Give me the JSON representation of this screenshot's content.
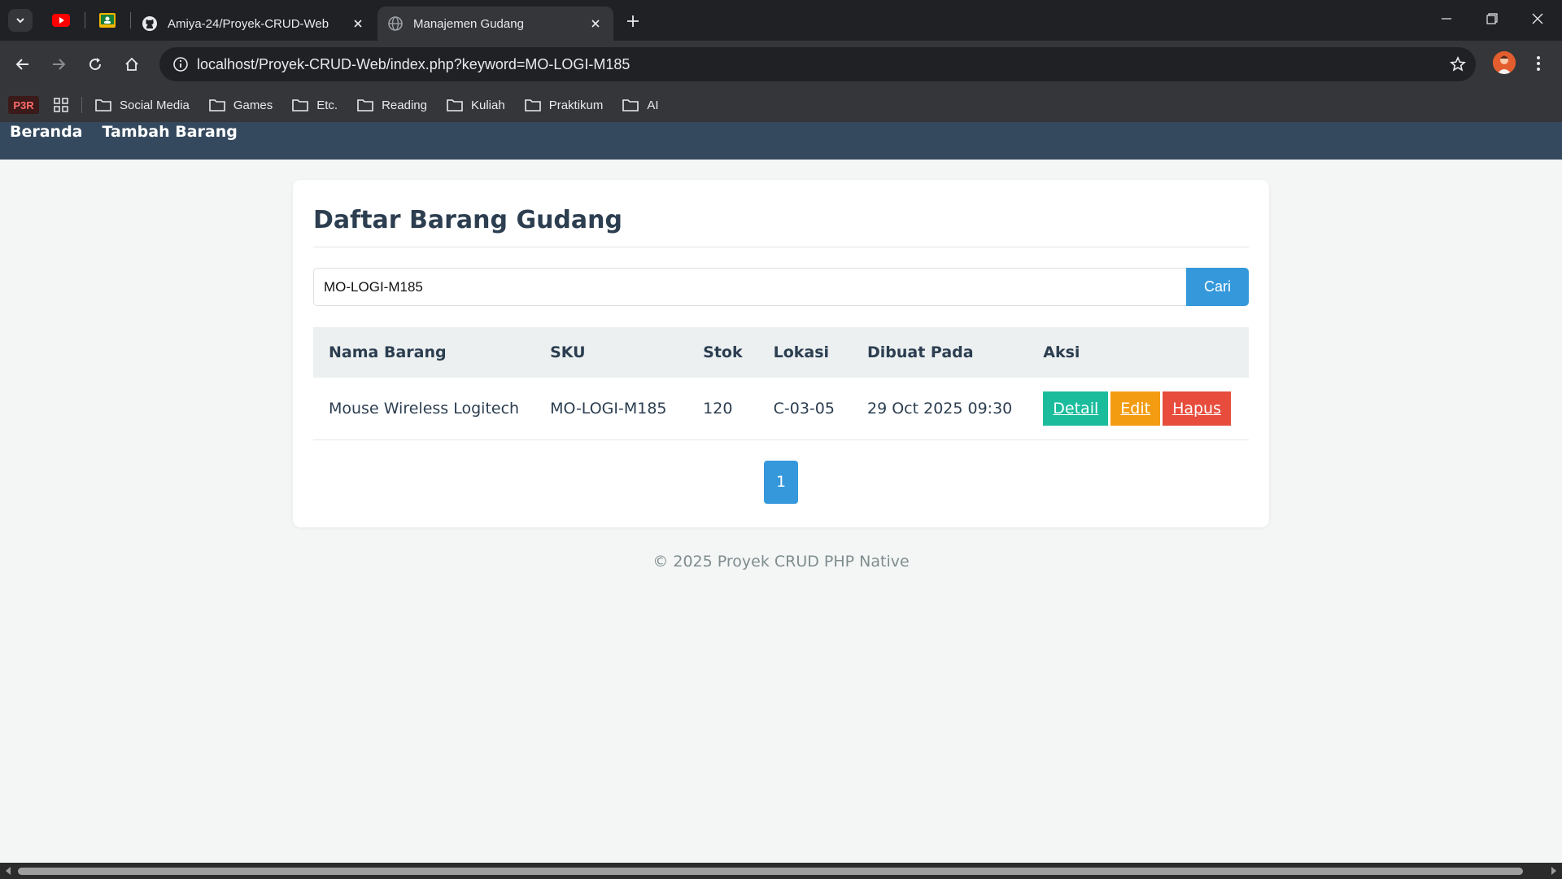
{
  "browser": {
    "tabs": [
      {
        "title": "Amiya-24/Proyek-CRUD-Web",
        "icon": "github-icon",
        "active": false
      },
      {
        "title": "Manajemen Gudang",
        "icon": "globe-icon",
        "active": true
      }
    ],
    "url": "localhost/Proyek-CRUD-Web/index.php?keyword=MO-LOGI-M185",
    "bookmarks": {
      "p3r_label": "P3R",
      "folders": [
        "Social Media",
        "Games",
        "Etc.",
        "Reading",
        "Kuliah",
        "Praktikum",
        "AI"
      ]
    }
  },
  "site_nav": {
    "home": "Beranda",
    "add_item": "Tambah Barang"
  },
  "main": {
    "title": "Daftar Barang Gudang",
    "search": {
      "value": "MO-LOGI-M185",
      "button": "Cari"
    },
    "table": {
      "headers": [
        "Nama Barang",
        "SKU",
        "Stok",
        "Lokasi",
        "Dibuat Pada",
        "Aksi"
      ],
      "rows": [
        {
          "nama": "Mouse Wireless Logitech",
          "sku": "MO-LOGI-M185",
          "stok": "120",
          "lokasi": "C-03-05",
          "dibuat": "29 Oct 2025 09:30",
          "actions": {
            "detail": "Detail",
            "edit": "Edit",
            "hapus": "Hapus"
          }
        }
      ]
    },
    "pagination": {
      "current": "1"
    }
  },
  "footer": "© 2025 Proyek CRUD PHP Native",
  "colors": {
    "nav_bg": "#34495e",
    "primary": "#3498db",
    "detail": "#1abc9c",
    "edit": "#f39c12",
    "hapus": "#e74c3c"
  }
}
